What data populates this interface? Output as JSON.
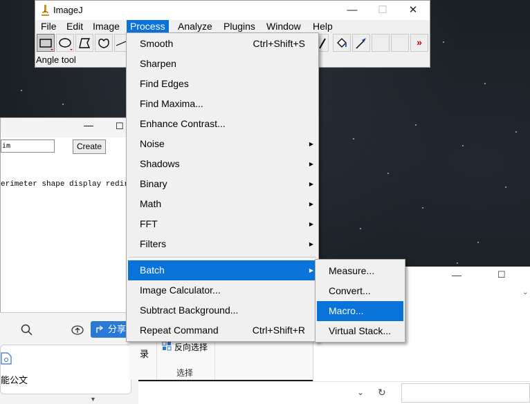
{
  "imagej": {
    "title": "ImageJ",
    "controls": {
      "minimize": "—",
      "maximize": "☐",
      "close": "✕"
    },
    "menus": [
      "File",
      "Edit",
      "Image",
      "Process",
      "Analyze",
      "Plugins",
      "Window",
      "Help"
    ],
    "active_menu": "Process",
    "toolbar": {
      "tools": [
        "rectangle-tool",
        "oval-tool",
        "polygon-tool",
        "freehand-tool",
        "line-tool",
        "dropper-tool",
        "flood-fill-tool",
        "arrow-tool",
        "blank-tool",
        "blank-tool"
      ],
      "more_label": "»"
    },
    "status": "Angle tool"
  },
  "process_menu": {
    "items": [
      {
        "label": "Smooth",
        "shortcut": "Ctrl+Shift+S",
        "submenu": false
      },
      {
        "label": "Sharpen",
        "shortcut": "",
        "submenu": false
      },
      {
        "label": "Find Edges",
        "shortcut": "",
        "submenu": false
      },
      {
        "label": "Find Maxima...",
        "shortcut": "",
        "submenu": false
      },
      {
        "label": "Enhance Contrast...",
        "shortcut": "",
        "submenu": false
      },
      {
        "label": "Noise",
        "shortcut": "",
        "submenu": true
      },
      {
        "label": "Shadows",
        "shortcut": "",
        "submenu": true
      },
      {
        "label": "Binary",
        "shortcut": "",
        "submenu": true
      },
      {
        "label": "Math",
        "shortcut": "",
        "submenu": true
      },
      {
        "label": "FFT",
        "shortcut": "",
        "submenu": true
      },
      {
        "label": "Filters",
        "shortcut": "",
        "submenu": true
      },
      {
        "label": "Batch",
        "shortcut": "",
        "submenu": true,
        "highlighted": true
      },
      {
        "label": "Image Calculator...",
        "shortcut": "",
        "submenu": false
      },
      {
        "label": "Subtract Background...",
        "shortcut": "",
        "submenu": false
      },
      {
        "label": "Repeat Command",
        "shortcut": "Ctrl+Shift+R",
        "submenu": false
      }
    ]
  },
  "batch_menu": {
    "items": [
      {
        "label": "Measure..."
      },
      {
        "label": "Convert..."
      },
      {
        "label": "Macro...",
        "highlighted": true
      },
      {
        "label": "Virtual Stack..."
      }
    ]
  },
  "left_window": {
    "name_value": "im",
    "create_label": "Create",
    "text_line": "erimeter shape display redirec"
  },
  "left_bottom": {
    "share_label": "分享",
    "card_label": "能公文"
  },
  "right_window": {
    "invert_selection_label": "反向选择",
    "select_group_label": "选择",
    "record_label": "录"
  },
  "colors": {
    "highlight": "#0a73d9",
    "menu_bg": "#f0f0f0",
    "desktop": "#171c21"
  }
}
